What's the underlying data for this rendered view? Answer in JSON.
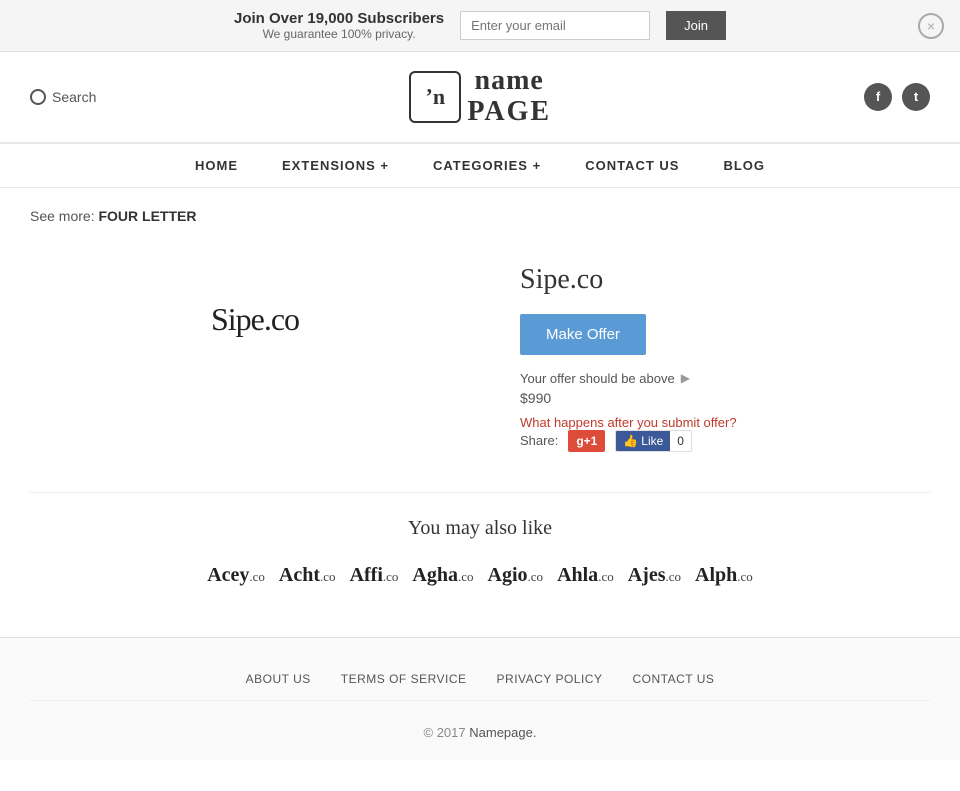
{
  "banner": {
    "main_text": "Join Over 19,000 Subscribers",
    "sub_text": "We guarantee 100% privacy.",
    "email_placeholder": "Enter your email",
    "join_label": "Join",
    "close_label": "×"
  },
  "header": {
    "search_label": "Search",
    "logo_icon": "ʼn",
    "logo_name": "name",
    "logo_page": "PAGE",
    "social": {
      "facebook_label": "f",
      "twitter_label": "t"
    }
  },
  "nav": {
    "items": [
      {
        "label": "HOME",
        "id": "home"
      },
      {
        "label": "EXTENSIONS +",
        "id": "extensions"
      },
      {
        "label": "CATEGORIES +",
        "id": "categories"
      },
      {
        "label": "CONTACT US",
        "id": "contact"
      },
      {
        "label": "BLOG",
        "id": "blog"
      }
    ]
  },
  "see_more": {
    "prefix": "See more:",
    "link_label": "FOUR LETTER"
  },
  "domain": {
    "logo_name": "Sipe",
    "logo_tld": ".co",
    "title": "Sipe.co",
    "make_offer_label": "Make Offer",
    "offer_hint": "Your offer should be above",
    "offer_amount": "$990",
    "what_happens_label": "What happens after you submit offer?",
    "share_label": "Share:",
    "gplus_label": "g+1",
    "fb_like_label": "Like",
    "fb_count": "0"
  },
  "also_like": {
    "title": "You may also like",
    "domains": [
      {
        "name": "Acey",
        "tld": ".co"
      },
      {
        "name": "Acht",
        "tld": ".co"
      },
      {
        "name": "Affi",
        "tld": ".co"
      },
      {
        "name": "Agha",
        "tld": ".co"
      },
      {
        "name": "Agio",
        "tld": ".co"
      },
      {
        "name": "Ahla",
        "tld": ".co"
      },
      {
        "name": "Ajes",
        "tld": ".co"
      },
      {
        "name": "Alph",
        "tld": ".co"
      }
    ]
  },
  "footer": {
    "links": [
      {
        "label": "ABOUT US"
      },
      {
        "label": "TERMS OF SERVICE"
      },
      {
        "label": "PRIVACY POLICY"
      },
      {
        "label": "CONTACT US"
      }
    ],
    "copyright_pre": "© 2017 ",
    "copyright_brand": "Namepage.",
    "copyright_post": ""
  }
}
